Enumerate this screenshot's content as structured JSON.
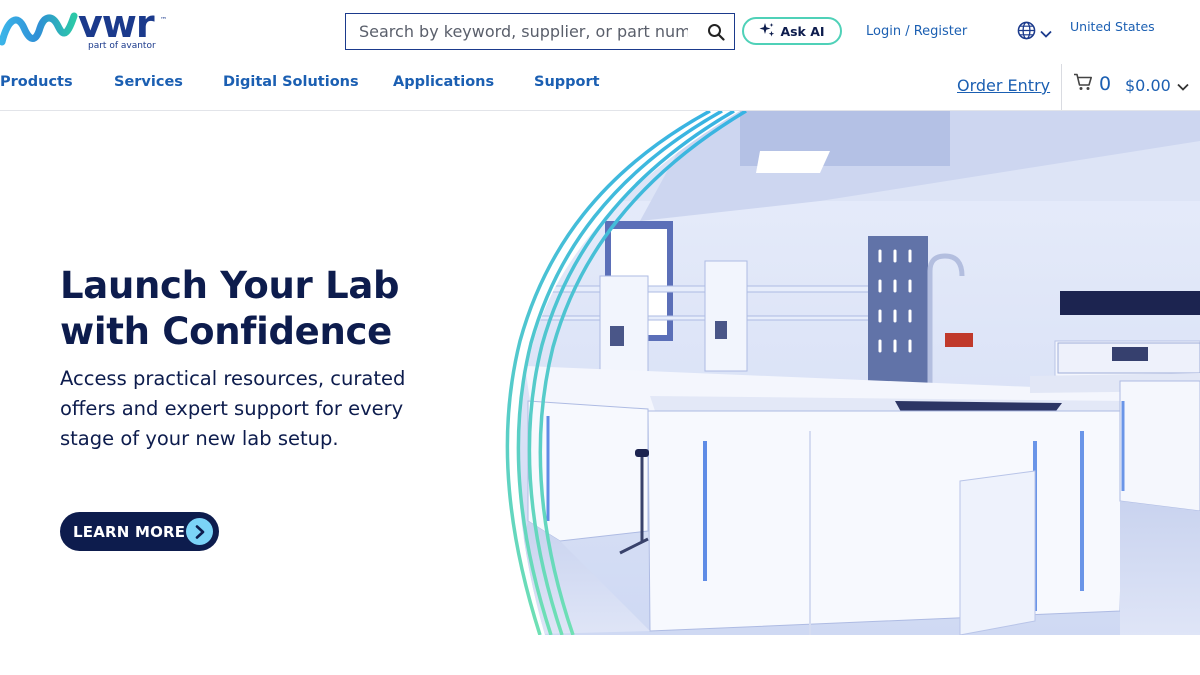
{
  "brand": {
    "name": "vwr",
    "trademark": "™",
    "tagline": "part of avantor",
    "colors": {
      "navy": "#0d1c4d",
      "blue": "#1b5fb2",
      "teal": "#4fd1b8",
      "cyan": "#7bd3f7"
    }
  },
  "header": {
    "search": {
      "placeholder": "Search by keyword, supplier, or part number",
      "value": "",
      "icon": "search-icon"
    },
    "ask_ai": {
      "label": "Ask AI",
      "icon": "sparkle-icon"
    },
    "login_label": "Login / Register",
    "language": {
      "icon": "globe-icon",
      "chevron": "chevron-down-icon"
    },
    "country": "United States"
  },
  "nav": {
    "items": [
      {
        "label": "Products"
      },
      {
        "label": "Services"
      },
      {
        "label": "Digital Solutions"
      },
      {
        "label": "Applications"
      },
      {
        "label": "Support"
      }
    ],
    "order_entry": "Order Entry",
    "cart": {
      "icon": "cart-icon",
      "count": "0",
      "total": "$0.00"
    }
  },
  "hero": {
    "title": "Launch Your Lab with Confidence",
    "description": "Access practical resources, curated offers and expert support for every stage of your new lab setup.",
    "cta_label": "LEARN MORE",
    "cta_icon": "chevron-right-icon",
    "image": "laboratory-photo"
  }
}
